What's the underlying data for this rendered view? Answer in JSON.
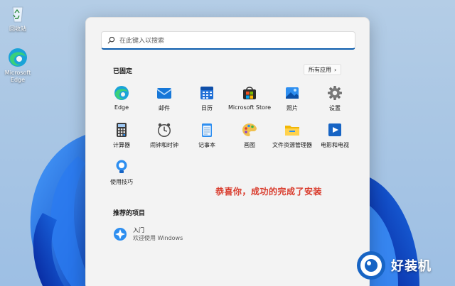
{
  "desktop": {
    "recycle_label": "回收站",
    "edge_label_1": "Microsoft",
    "edge_label_2": "Edge"
  },
  "start": {
    "search_placeholder": "在此键入以搜索",
    "pinned_title": "已固定",
    "all_apps_label": "所有应用",
    "all_apps_chevron": "›",
    "pinned": [
      {
        "label": "Edge",
        "icon": "edge-icon"
      },
      {
        "label": "邮件",
        "icon": "mail-icon"
      },
      {
        "label": "日历",
        "icon": "calendar-icon"
      },
      {
        "label": "Microsoft Store",
        "icon": "store-icon"
      },
      {
        "label": "照片",
        "icon": "photos-icon"
      },
      {
        "label": "设置",
        "icon": "gear-icon"
      },
      {
        "label": "计算器",
        "icon": "calculator-icon"
      },
      {
        "label": "闹钟和时钟",
        "icon": "clock-icon"
      },
      {
        "label": "记事本",
        "icon": "notepad-icon"
      },
      {
        "label": "画图",
        "icon": "paint-icon"
      },
      {
        "label": "文件资源管理器",
        "icon": "folder-icon"
      },
      {
        "label": "电影和电视",
        "icon": "video-icon"
      },
      {
        "label": "使用技巧",
        "icon": "tips-icon"
      }
    ],
    "overlay_text": "恭喜你，成功的完成了安装",
    "recommended_title": "推荐的项目",
    "recommended": [
      {
        "title": "入门",
        "subtitle": "欢迎使用 Windows",
        "icon": "get-started-icon"
      }
    ]
  },
  "watermark": {
    "text": "好装机"
  },
  "colors": {
    "accent": "#0b5cad",
    "congrats_red": "#d93a2b",
    "menu_bg": "#f3f3f3"
  }
}
